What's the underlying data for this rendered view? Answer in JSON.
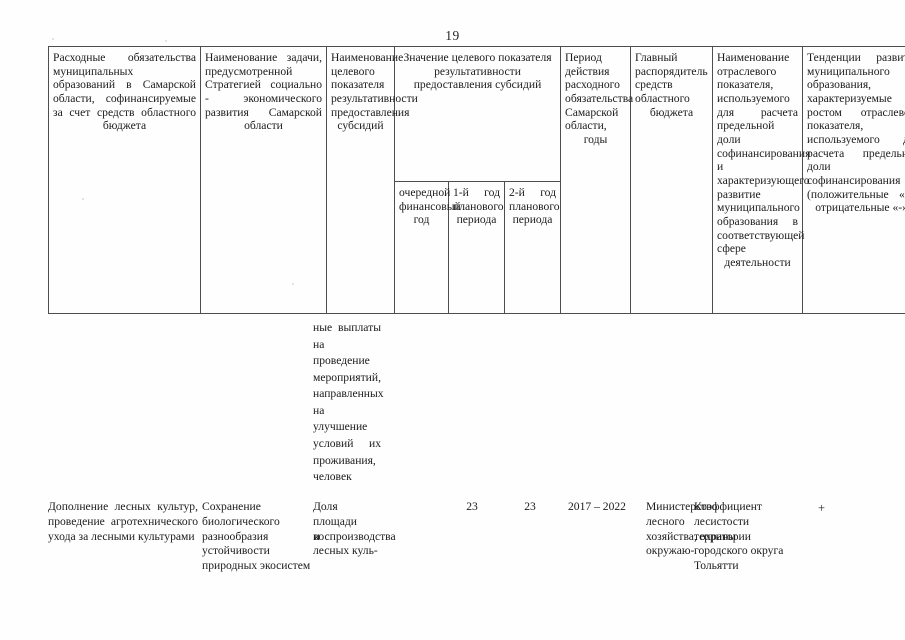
{
  "document": {
    "page_number": "19",
    "language": "ru"
  },
  "table": {
    "headers": {
      "col1": "Расходные обязательства муниципальных образований в Самарской области, софинансируемые за счет средств областного бюджета",
      "col2": "Наименование задачи, предусмотренной Стратегией социально - экономического развития Самарской области",
      "col3": "Наименование целевого показателя результативности предоставления субсидий",
      "col4_group": "Значение целевого показателя результативности предоставления субсидий",
      "col4_sub1": "очередной финансовый год",
      "col4_sub2": "1-й год планового периода",
      "col4_sub3": "2-й год планового периода",
      "col5": "Период действия расходного обязательства Самарской области, годы",
      "col6": "Главный распорядитель средств областного бюджета",
      "col7": "Наименование отраслевого показателя, используемого для расчета предельной доли софинансирования и характеризующего развитие муниципального образования в соответствующей сфере деятельности",
      "col8": "Тенденции развития муниципального образования, характеризуемые ростом отраслевого показателя, используемого для расчета предельной доли софинансирования (положительные «+», отрицательные «-»)"
    },
    "continuation": {
      "col3_carryover": "ные выплаты на проведение мероприятий, направленных на улучшение условий их проживания, человек"
    },
    "rows": [
      {
        "expenditure_obligation": "Дополнение лесных культур, проведение агротехнического ухода за лесными культурами",
        "strategy_task": "Сохранение биологического разнообразия и устойчивости природных экосистем",
        "target_indicator": "Доля площади воспроизводства лесных куль-",
        "value_current_year": "",
        "value_year_1": "23",
        "value_year_2": "23",
        "period_years": "2017 – 2022",
        "main_administrator": "Министерство лесного хозяйства, охраны окружаю-",
        "sector_indicator": "Коэффициент лесистости территории городского округа Тольятти",
        "trend": "+"
      }
    ]
  }
}
